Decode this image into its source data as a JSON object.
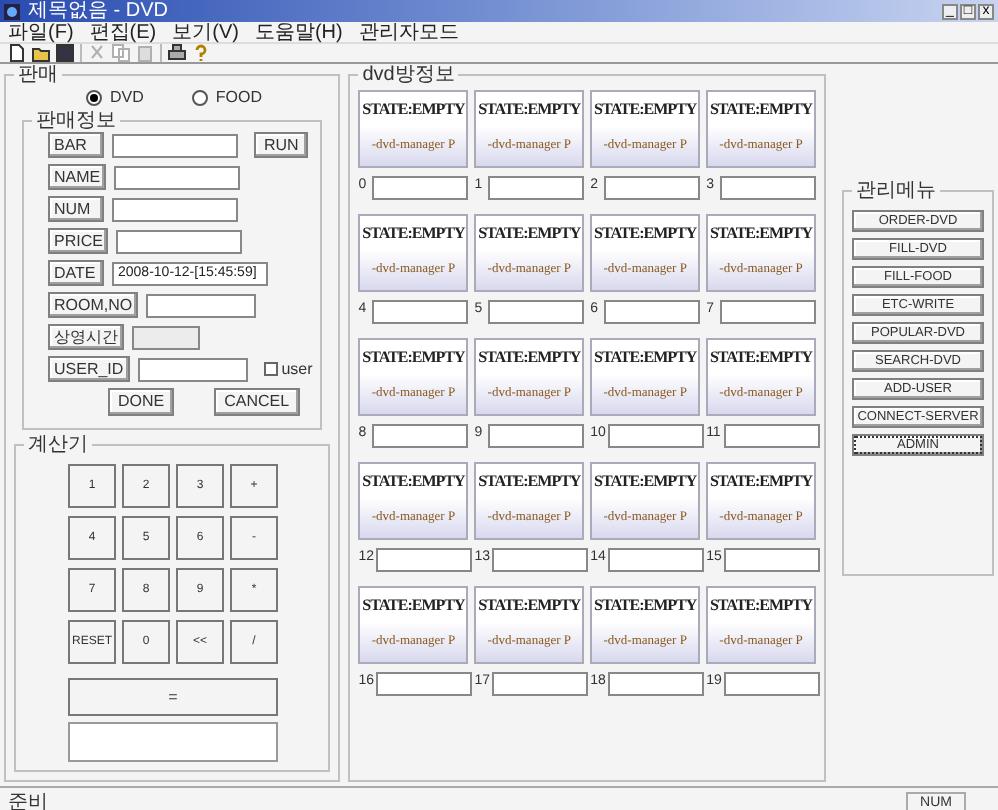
{
  "window": {
    "title": "제목없음 - DVD",
    "controls": [
      "_",
      "□",
      "x"
    ]
  },
  "menu": [
    "파일(F)",
    "편집(E)",
    "보기(V)",
    "도움말(H)",
    "관리자모드"
  ],
  "sale": {
    "title": "판매",
    "modes": [
      {
        "label": "DVD",
        "selected": true
      },
      {
        "label": "FOOD",
        "selected": false
      }
    ],
    "info": {
      "title": "판매정보",
      "run": "RUN",
      "fields": [
        {
          "label": "BAR",
          "disabled": false
        },
        {
          "label": "NAME",
          "disabled": false
        },
        {
          "label": "NUM",
          "disabled": false
        },
        {
          "label": "PRICE",
          "disabled": false
        },
        {
          "label": "DATE",
          "value": "2008-10-12-[15:45:59]",
          "disabled": false
        },
        {
          "label": "ROOM,NO",
          "disabled": false
        },
        {
          "label": "상영시간",
          "disabled": true
        },
        {
          "label": "USER_ID",
          "disabled": false
        }
      ],
      "user_checkbox": {
        "label": "user",
        "checked": false
      },
      "buttons": [
        "DONE",
        "CANCEL"
      ]
    },
    "calculator": {
      "title": "계산기",
      "keys": [
        "1",
        "2",
        "3",
        "+",
        "4",
        "5",
        "6",
        "-",
        "7",
        "8",
        "9",
        "*",
        "RESET",
        "0",
        "<<",
        "/"
      ],
      "equals": "="
    }
  },
  "rooms": {
    "title": "dvd방정보",
    "items": [
      {
        "number": "0",
        "state": "STATE:EMPTY",
        "caption": "-dvd-manager P"
      },
      {
        "number": "1",
        "state": "STATE:EMPTY",
        "caption": "-dvd-manager P"
      },
      {
        "number": "2",
        "state": "STATE:EMPTY",
        "caption": "-dvd-manager P"
      },
      {
        "number": "3",
        "state": "STATE:EMPTY",
        "caption": "-dvd-manager P"
      },
      {
        "number": "4",
        "state": "STATE:EMPTY",
        "caption": "-dvd-manager P"
      },
      {
        "number": "5",
        "state": "STATE:EMPTY",
        "caption": "-dvd-manager P"
      },
      {
        "number": "6",
        "state": "STATE:EMPTY",
        "caption": "-dvd-manager P"
      },
      {
        "number": "7",
        "state": "STATE:EMPTY",
        "caption": "-dvd-manager P"
      },
      {
        "number": "8",
        "state": "STATE:EMPTY",
        "caption": "-dvd-manager P"
      },
      {
        "number": "9",
        "state": "STATE:EMPTY",
        "caption": "-dvd-manager P"
      },
      {
        "number": "10",
        "state": "STATE:EMPTY",
        "caption": "-dvd-manager P"
      },
      {
        "number": "11",
        "state": "STATE:EMPTY",
        "caption": "-dvd-manager P"
      },
      {
        "number": "12",
        "state": "STATE:EMPTY",
        "caption": "-dvd-manager P"
      },
      {
        "number": "13",
        "state": "STATE:EMPTY",
        "caption": "-dvd-manager P"
      },
      {
        "number": "14",
        "state": "STATE:EMPTY",
        "caption": "-dvd-manager P"
      },
      {
        "number": "15",
        "state": "STATE:EMPTY",
        "caption": "-dvd-manager P"
      },
      {
        "number": "16",
        "state": "STATE:EMPTY",
        "caption": "-dvd-manager P"
      },
      {
        "number": "17",
        "state": "STATE:EMPTY",
        "caption": "-dvd-manager P"
      },
      {
        "number": "18",
        "state": "STATE:EMPTY",
        "caption": "-dvd-manager P"
      },
      {
        "number": "19",
        "state": "STATE:EMPTY",
        "caption": "-dvd-manager P"
      }
    ]
  },
  "admin_menu": {
    "title": "관리메뉴",
    "buttons": [
      {
        "label": "ORDER-DVD",
        "focused": false
      },
      {
        "label": "FILL-DVD",
        "focused": false
      },
      {
        "label": "FILL-FOOD",
        "focused": false
      },
      {
        "label": "ETC-WRITE",
        "focused": false
      },
      {
        "label": "POPULAR-DVD",
        "focused": false
      },
      {
        "label": "SEARCH-DVD",
        "focused": false
      },
      {
        "label": "ADD-USER",
        "focused": false
      },
      {
        "label": "CONNECT-SERVER",
        "focused": false
      },
      {
        "label": "ADMIN",
        "focused": true
      }
    ]
  },
  "status_bar": {
    "message": "준비",
    "indicator": "NUM"
  }
}
